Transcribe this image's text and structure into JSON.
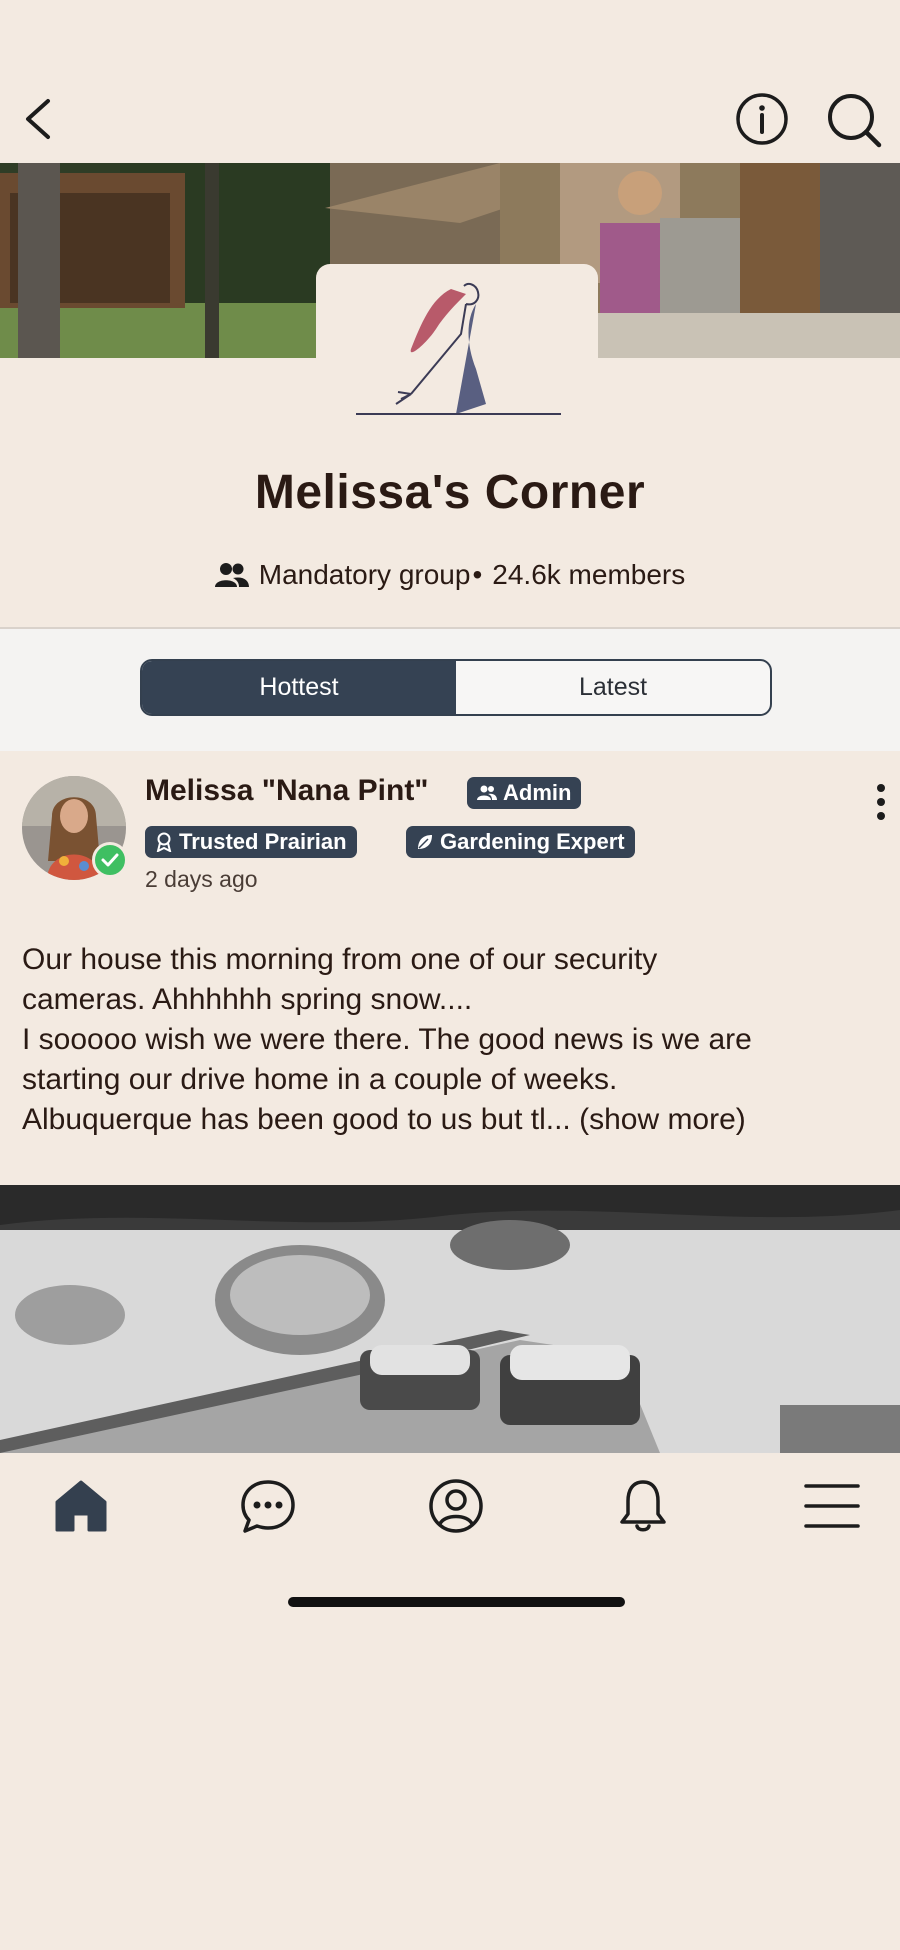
{
  "header": {
    "back_icon": "chevron-left-icon",
    "info_icon": "info-icon",
    "search_icon": "search-icon"
  },
  "group": {
    "name": "Melissa's Corner",
    "type": "Mandatory group",
    "separator": "•",
    "members": "24.6k members"
  },
  "tabs": [
    {
      "label": "Hottest",
      "active": true
    },
    {
      "label": "Latest",
      "active": false
    }
  ],
  "post": {
    "author": "Melissa \"Nana Pint\"",
    "badges": {
      "admin": "Admin",
      "trusted": "Trusted Prairian",
      "gardening": "Gardening Expert"
    },
    "time": "2 days ago",
    "text_lines": [
      "Our house this morning from one of our security",
      "cameras. Ahhhhhh spring snow....",
      "I sooooo wish we were there. The good news is we are",
      "starting our drive home in a couple of weeks.",
      "Albuquerque has been good to us but tl... (show more)"
    ]
  },
  "nav": {
    "items": [
      "home-icon",
      "chat-icon",
      "profile-icon",
      "bell-icon",
      "menu-icon"
    ]
  },
  "colors": {
    "background": "#f3eae1",
    "accent": "#354253",
    "verified": "#3fbf62"
  }
}
